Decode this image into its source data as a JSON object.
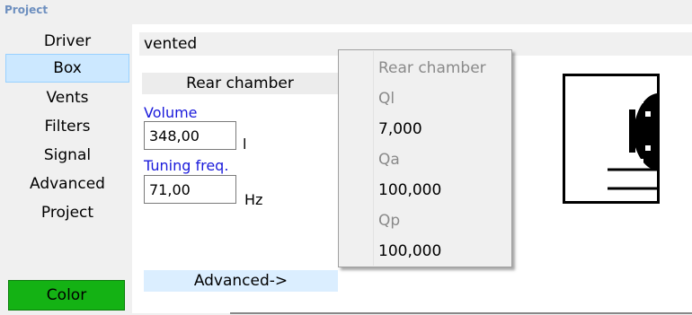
{
  "window": {
    "title": "Project"
  },
  "sidebar": {
    "items": [
      {
        "label": "Driver",
        "active": false
      },
      {
        "label": "Box",
        "active": true
      },
      {
        "label": "Vents",
        "active": false
      },
      {
        "label": "Filters",
        "active": false
      },
      {
        "label": "Signal",
        "active": false
      },
      {
        "label": "Advanced",
        "active": false
      },
      {
        "label": "Project",
        "active": false
      }
    ],
    "color_button": {
      "label": "Color",
      "color": "#14b214"
    }
  },
  "box": {
    "type_value": "vented",
    "section_header": "Rear chamber",
    "volume": {
      "label": "Volume",
      "value": "348,00",
      "unit": "l"
    },
    "tuning": {
      "label": "Tuning freq.",
      "value": "71,00",
      "unit": "Hz"
    },
    "advanced_button": "Advanced->"
  },
  "context_menu": {
    "items": [
      {
        "label": "Rear chamber",
        "disabled": true
      },
      {
        "label": "Ql",
        "disabled": true
      },
      {
        "label": "7,000",
        "disabled": false
      },
      {
        "label": "Qa",
        "disabled": true
      },
      {
        "label": "100,000",
        "disabled": false
      },
      {
        "label": "Qp",
        "disabled": true
      },
      {
        "label": "100,000",
        "disabled": false
      }
    ]
  },
  "colors": {
    "label_blue": "#1a1adb",
    "selection": "#cce8ff",
    "title_blue": "#6d8fbf"
  }
}
